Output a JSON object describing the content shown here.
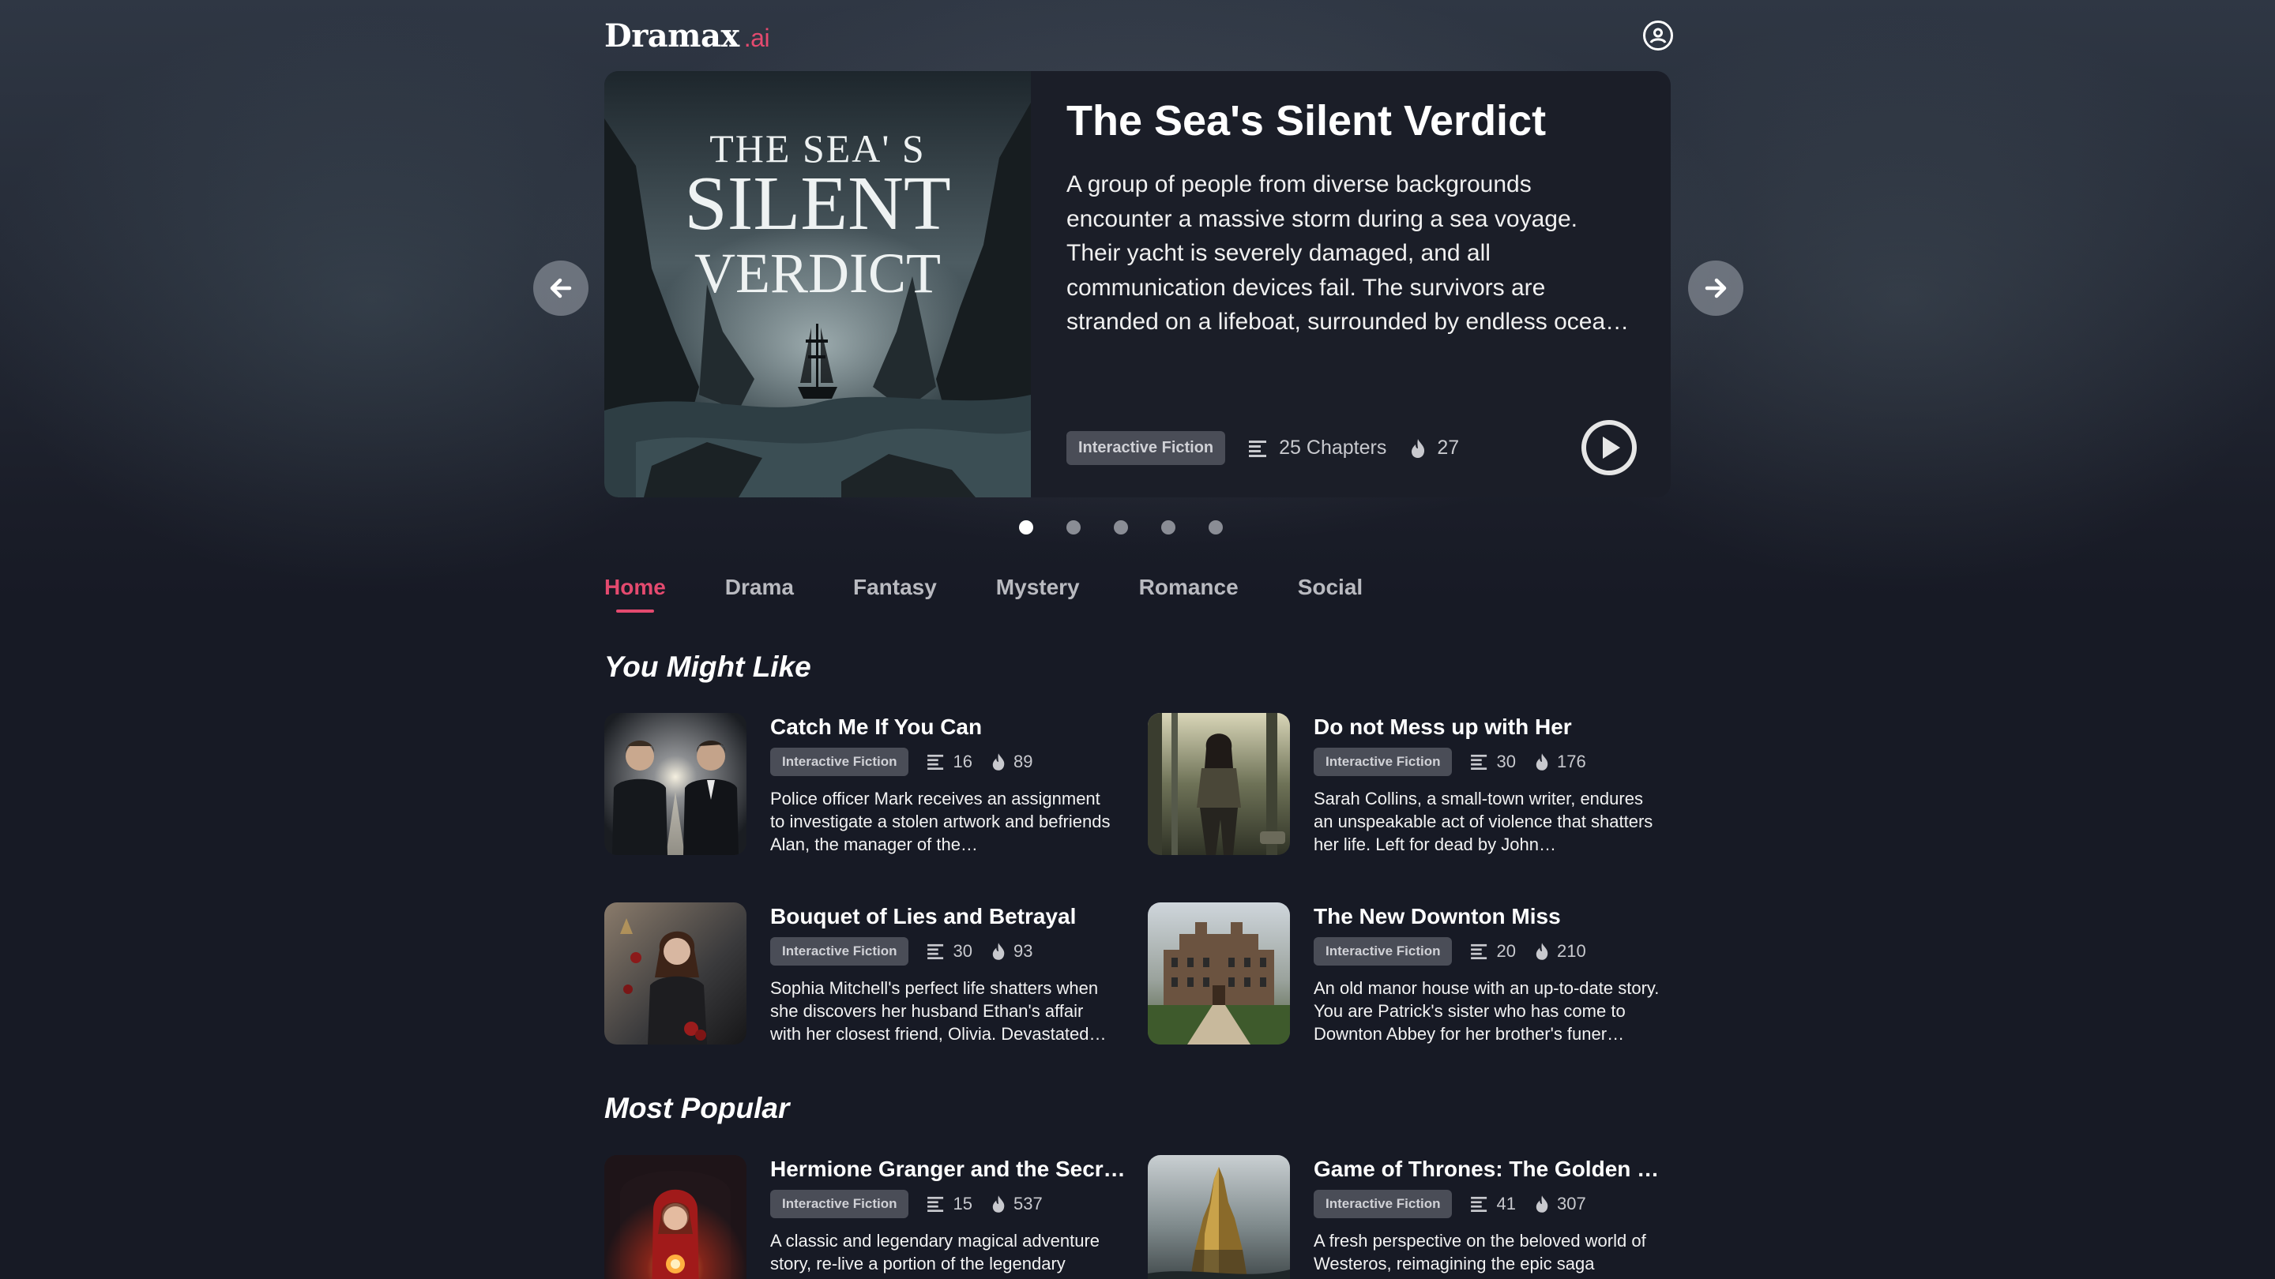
{
  "header": {
    "logo_text": "Dramax",
    "logo_suffix": ".ai"
  },
  "hero": {
    "title": "The Sea's Silent Verdict",
    "cover_text": [
      "THE SEA' S",
      "SILENT",
      "VERDICT"
    ],
    "description": "A group of people from diverse backgrounds encounter a massive storm during a sea voyage. Their yacht is severely damaged, and all communication devices fail. The survivors are stranded on a lifeboat, surrounded by endless ocea…",
    "tag": "Interactive Fiction",
    "chapters": "25 Chapters",
    "plays": "27",
    "slide_count": 5,
    "active_slide": 1
  },
  "tabs": [
    "Home",
    "Drama",
    "Fantasy",
    "Mystery",
    "Romance",
    "Social"
  ],
  "sections": {
    "you_might_like": {
      "title": "You Might Like",
      "cards": [
        {
          "title": "Catch Me If You Can",
          "tag": "Interactive Fiction",
          "chapters": "16",
          "plays": "89",
          "description": "Police officer Mark receives an assignment to investigate a stolen artwork and befriends Alan, the manager of the…"
        },
        {
          "title": "Do not Mess up with Her",
          "tag": "Interactive Fiction",
          "chapters": "30",
          "plays": "176",
          "description": "Sarah Collins, a small-town writer, endures an unspeakable act of violence that shatters her life. Left for dead by John…"
        },
        {
          "title": "Bouquet of Lies and Betrayal",
          "tag": "Interactive Fiction",
          "chapters": "30",
          "plays": "93",
          "description": "Sophia Mitchell's perfect life shatters when she discovers her husband Ethan's affair with her closest friend, Olivia. Devastated…"
        },
        {
          "title": "The New Downton Miss",
          "tag": "Interactive Fiction",
          "chapters": "20",
          "plays": "210",
          "description": "An old manor house with an up-to-date story. You are Patrick's sister who has come to Downton Abbey for her brother's funer…"
        }
      ]
    },
    "most_popular": {
      "title": "Most Popular",
      "cards": [
        {
          "title": "Hermione Granger and the Secr…",
          "tag": "Interactive Fiction",
          "chapters": "15",
          "plays": "537",
          "description": "A classic and legendary magical adventure story, re-live a portion of the legendary"
        },
        {
          "title": "Game of Thrones: The Golden …",
          "tag": "Interactive Fiction",
          "chapters": "41",
          "plays": "307",
          "description": "A fresh perspective on the beloved world of Westeros, reimagining the epic saga"
        }
      ]
    }
  },
  "colors": {
    "accent": "#e44a6f",
    "background": "#171a25",
    "tag_bg": "#4a4d57"
  },
  "icons": [
    "user-circle-icon",
    "arrow-left-icon",
    "arrow-right-icon",
    "play-icon",
    "chapters-list-icon",
    "flame-icon"
  ]
}
